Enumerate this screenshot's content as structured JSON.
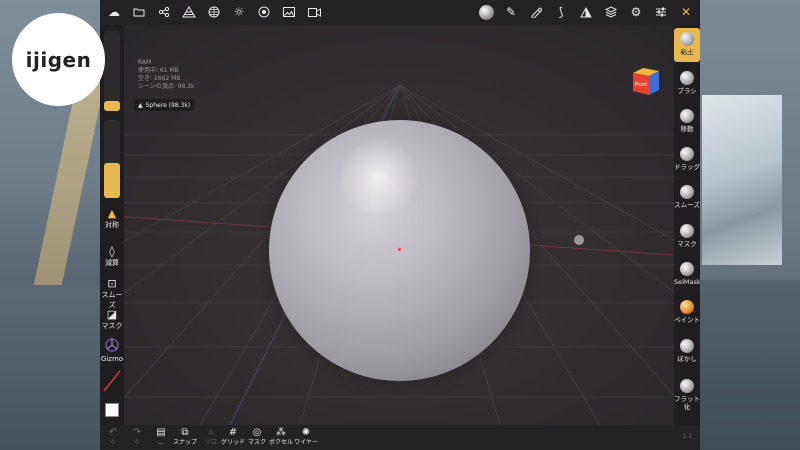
{
  "logo": {
    "text": "ijigen"
  },
  "viewport_info": {
    "ram_label": "RAM",
    "ram_used": "使用中: 61 MB",
    "ram_free": "空き: 1662 MB",
    "scene_vertices": "シーンの頂点: 98.3k"
  },
  "mesh_tag": {
    "icon": "triangle-icon",
    "label": "Sphere (98.3k)"
  },
  "view_cube": {
    "label": "Front",
    "colors": {
      "front": "#e8412f",
      "side": "#3a6fd8",
      "top": "#f0b740"
    }
  },
  "left_panel": {
    "symmetry_label": "対称",
    "items": [
      {
        "icon": "drop-icon",
        "label": "減算"
      },
      {
        "icon": "smooth-icon",
        "label": "スムーズ"
      },
      {
        "icon": "mask-icon",
        "label": "マスク"
      },
      {
        "icon": "gizmo-icon",
        "label": "Gizmo"
      }
    ],
    "radius_fill": 0.12,
    "intensity_fill": 0.45
  },
  "right_panel": {
    "tools": [
      {
        "label": "粘土",
        "active": true
      },
      {
        "label": "ブラシ",
        "active": false
      },
      {
        "label": "移動",
        "active": false
      },
      {
        "label": "ドラッグ",
        "active": false
      },
      {
        "label": "スムーズ",
        "active": false
      },
      {
        "label": "マスク",
        "active": false
      },
      {
        "label": "SelMask",
        "active": false
      },
      {
        "label": "ペイント",
        "active": false
      },
      {
        "label": "ぼかし",
        "active": false
      },
      {
        "label": "フラット化",
        "active": false
      }
    ]
  },
  "bottom_bar": {
    "items": [
      {
        "icon": "undo-icon",
        "label": "0",
        "dim": true
      },
      {
        "icon": "redo-icon",
        "label": "0",
        "dim": true
      },
      {
        "icon": "layers-icon",
        "label": "...",
        "dim": false
      },
      {
        "icon": "snap-icon",
        "label": "スナップ",
        "dim": false
      },
      {
        "icon": "search-icon",
        "label": "ソロ",
        "dim": true
      },
      {
        "icon": "grid-icon",
        "label": "グリッド",
        "dim": false
      },
      {
        "icon": "mask-eye-icon",
        "label": "マスク",
        "dim": false
      },
      {
        "icon": "voxel-icon",
        "label": "ボクセル",
        "dim": false
      },
      {
        "icon": "wire-icon",
        "label": "ワイヤー",
        "dim": false
      }
    ],
    "right_text": "1.1"
  },
  "colors": {
    "accent": "#e6b84d",
    "panel": "#1f1d1f",
    "viewport": "#302c2e"
  }
}
